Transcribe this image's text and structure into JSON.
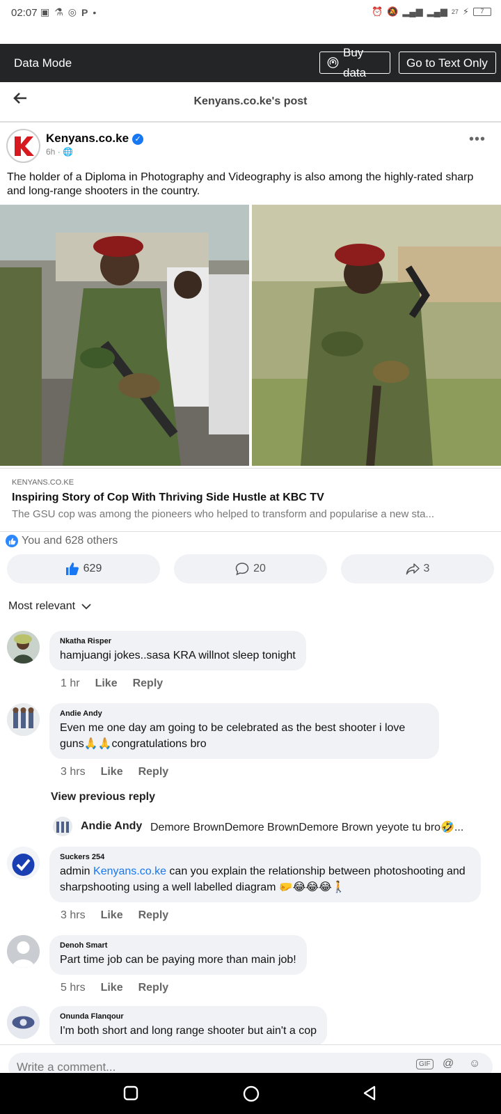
{
  "status_bar": {
    "time": "02:07",
    "network_text": "27",
    "battery": "7"
  },
  "data_bar": {
    "label": "Data Mode",
    "buy_label": "Buy data",
    "text_only_label": "Go to Text Only"
  },
  "header": {
    "title": "Kenyans.co.ke's post"
  },
  "post": {
    "author": "Kenyans.co.ke",
    "time": "6h",
    "privacy_separator": "·",
    "text": "The holder of a Diploma in Photography and Videography is also among the highly-rated sharp and long-range shooters in the country.",
    "link": {
      "domain": "KENYANS.CO.KE",
      "headline": "Inspiring Story of Cop With Thriving Side Hustle at KBC TV",
      "description": "The GSU cop was among the pioneers who helped to transform and popularise a new sta..."
    },
    "reactions_text": "You and 628 others",
    "like_count": "629",
    "comment_count": "20",
    "share_count": "3"
  },
  "sort_label": "Most relevant",
  "comments": [
    {
      "name": "Nkatha Risper",
      "text": "hamjuangi jokes..sasa KRA willnot sleep tonight",
      "time": "1 hr",
      "like": "Like",
      "reply": "Reply"
    },
    {
      "name": "Andie Andy",
      "text": "Even me one day am going to be celebrated as the best shooter i love guns🙏🙏congratulations bro",
      "time": "3 hrs",
      "like": "Like",
      "reply": "Reply"
    },
    {
      "name": "Suckers 254",
      "text_prefix": "admin ",
      "text_link": "Kenyans.co.ke",
      "text_suffix": " can you explain the relationship between photoshooting and sharpshooting using a well labelled diagram 🤛😂😂😂🚶",
      "time": "3 hrs",
      "like": "Like",
      "reply": "Reply"
    },
    {
      "name": "Denoh Smart",
      "text": "Part time job can be paying more than main job!",
      "time": "5 hrs",
      "like": "Like",
      "reply": "Reply"
    },
    {
      "name": "Onunda Flanqour",
      "text": "I'm both short and long range shooter but ain't a cop"
    }
  ],
  "view_previous_reply": "View previous reply",
  "reply_preview": {
    "name": "Andie Andy",
    "text": "Demore BrownDemore BrownDemore Brown yeyote tu bro🤣..."
  },
  "composer": {
    "placeholder": "Write a comment...",
    "gif_label": "GIF"
  }
}
